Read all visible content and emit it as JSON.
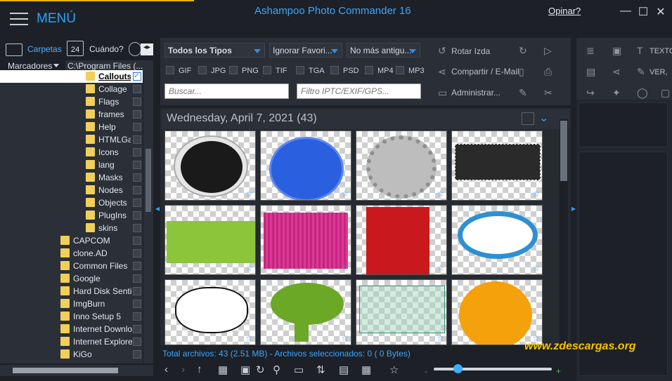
{
  "header": {
    "menu_label": "MENÚ",
    "app_title": "Ashampoo Photo Commander 16",
    "feedback_link": "Opinar?",
    "win_min": "—",
    "win_max": "☐",
    "win_close": "✕"
  },
  "left": {
    "tab_folders": "Carpetas",
    "calendar_day": "24",
    "tab_when": "Cuándo?",
    "bookmarks": "Marcadores",
    "path": "C:\\Program Files (...",
    "tree": [
      {
        "label": "Callouts",
        "indent": 2,
        "selected": true
      },
      {
        "label": "Collage",
        "indent": 2
      },
      {
        "label": "Flags",
        "indent": 2
      },
      {
        "label": "frames",
        "indent": 2
      },
      {
        "label": "Help",
        "indent": 2
      },
      {
        "label": "HTMLGa",
        "indent": 2
      },
      {
        "label": "Icons",
        "indent": 2
      },
      {
        "label": "lang",
        "indent": 2
      },
      {
        "label": "Masks",
        "indent": 2
      },
      {
        "label": "Nodes",
        "indent": 2
      },
      {
        "label": "Objects",
        "indent": 2
      },
      {
        "label": "PlugIns",
        "indent": 2
      },
      {
        "label": "skins",
        "indent": 2
      },
      {
        "label": "CAPCOM",
        "indent": 1
      },
      {
        "label": "clone.AD",
        "indent": 1
      },
      {
        "label": "Common Files",
        "indent": 1
      },
      {
        "label": "Google",
        "indent": 1
      },
      {
        "label": "Hard Disk Sentir",
        "indent": 1
      },
      {
        "label": "ImgBurn",
        "indent": 1
      },
      {
        "label": "Inno Setup 5",
        "indent": 1
      },
      {
        "label": "Internet Downlo",
        "indent": 1
      },
      {
        "label": "Internet Explorer",
        "indent": 1
      },
      {
        "label": "KiGo",
        "indent": 1
      }
    ]
  },
  "filters": {
    "type_dd": "Todos los Tipos",
    "fav_dd": "Ignorar Favori...",
    "age_dd": "No más antigu...",
    "exts": [
      "GIF",
      "JPG",
      "PNG",
      "TIF",
      "TGA",
      "PSD",
      "MP4",
      "MP3"
    ],
    "search_placeholder": "Buscar...",
    "exif_placeholder": "Filtro IPTC/EXIF/GPS...",
    "rotate": "Rotar Izda",
    "share": "Compartir / E-Mail",
    "manage": "Administrar..."
  },
  "right": {
    "text_btn": "TEXTO",
    "view_btn": "VER, "
  },
  "gallery": {
    "date_header": "Wednesday, April 7, 2021 (43)",
    "thumbs": [
      "sticker",
      "blue-circle",
      "bottle-cap",
      "dark-banner",
      "green-banner",
      "pink-banner",
      "red-banner",
      "blue-bubble",
      "white-bubble",
      "green-bubble",
      "checker-bubble",
      "orange-bubble"
    ]
  },
  "status": {
    "text": "Total archivos: 43 (2.51 MB) - Archivos seleccionados: 0 (   0 Bytes)",
    "watermark": "www.zdescargas.org",
    "zoom_minus": "-",
    "zoom_plus": "+",
    "zoom_level": 0.2
  }
}
